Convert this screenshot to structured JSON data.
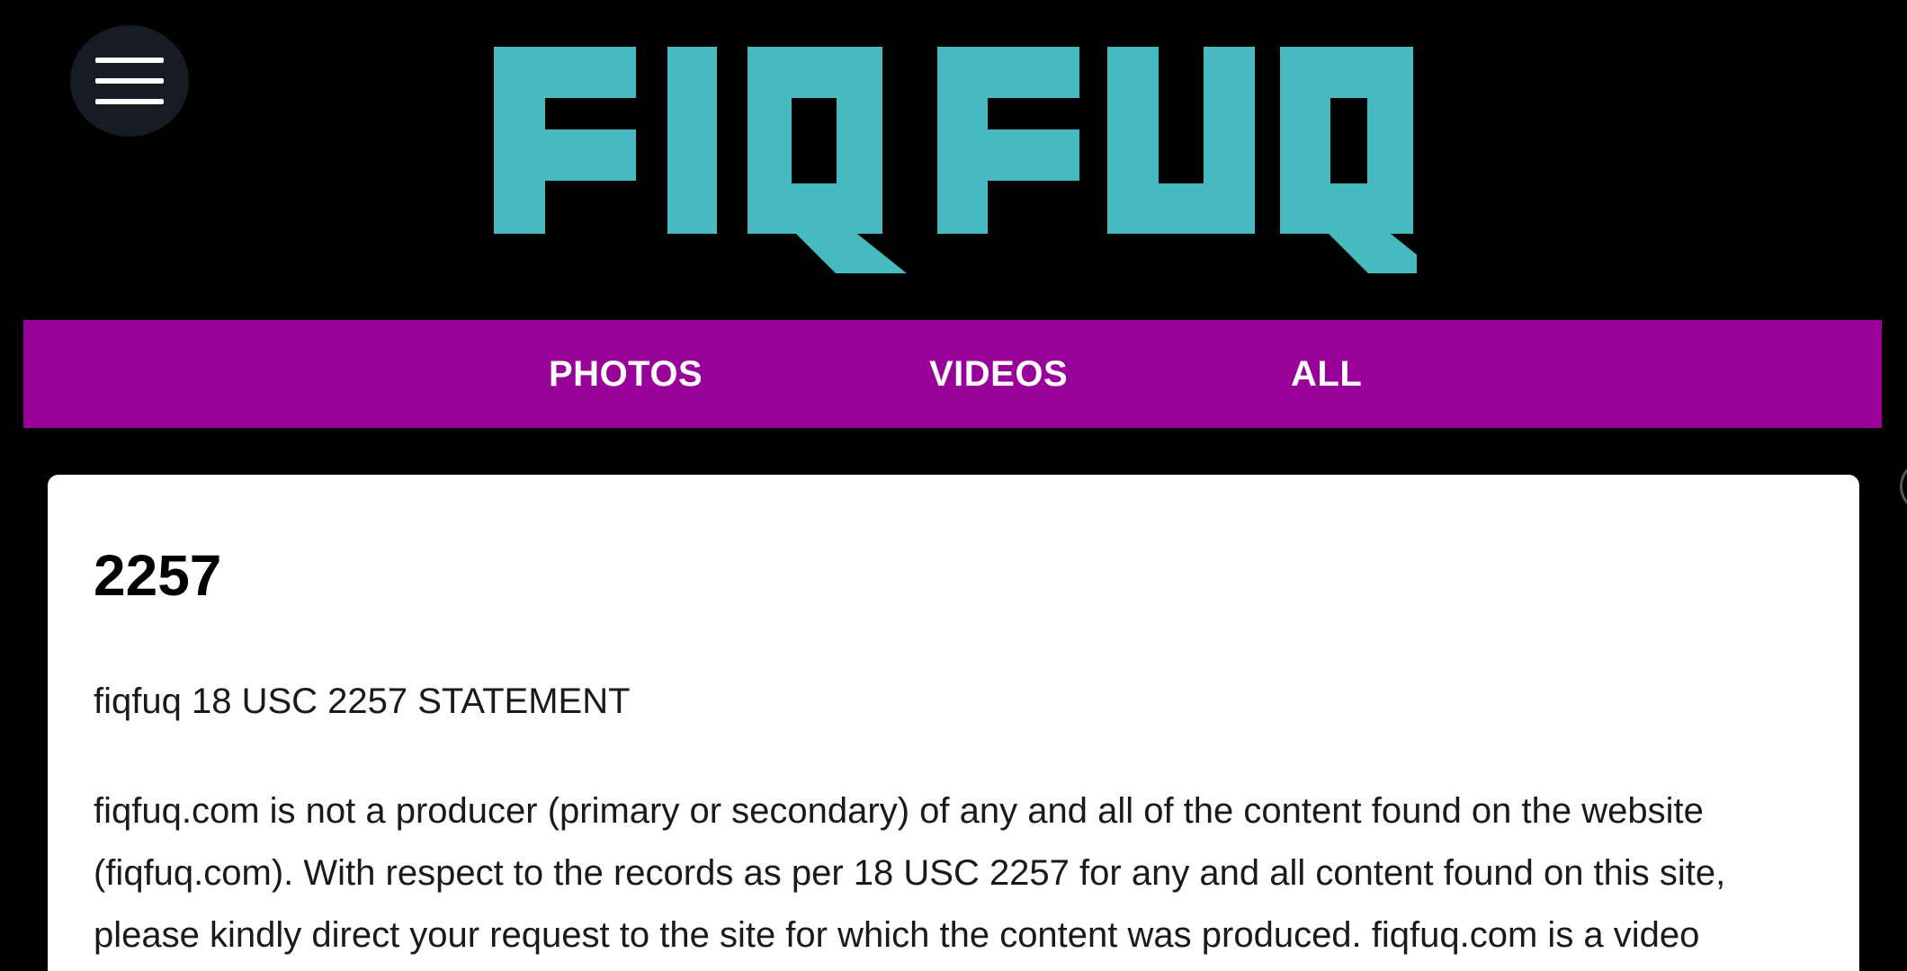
{
  "header": {
    "menu_icon": "hamburger-menu-icon",
    "logo_text": "FIQFUQ",
    "logo_color": "#47b9c0"
  },
  "nav": {
    "background": "#990099",
    "items": [
      {
        "label": "PHOTOS"
      },
      {
        "label": "VIDEOS"
      },
      {
        "label": "ALL"
      }
    ]
  },
  "content": {
    "title": "2257",
    "subtitle": "fiqfuq 18 USC 2257 STATEMENT",
    "body_lines": [
      "fiqfuq.com is not a producer (primary or secondary) of any and all of the content found on the website",
      "(fiqfuq.com). With respect to the records as per 18 USC 2257 for any and all content found on this site,",
      "please kindly direct your request to the site for which the content was produced. fiqfuq.com is a video"
    ]
  }
}
